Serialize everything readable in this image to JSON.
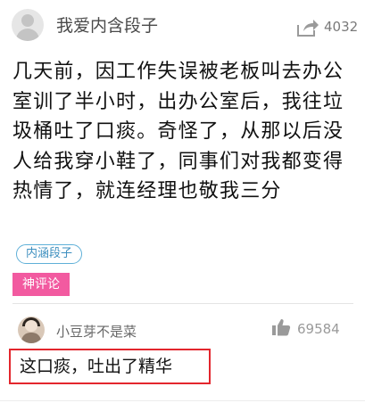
{
  "post": {
    "author": "我爱内含段子",
    "share_count": "4032",
    "content": "几天前，因工作失误被老板叫去办公室训了半小时，出办公室后，我往垃圾桶吐了口痰。奇怪了，从那以后没人给我穿小鞋了，同事们对我都变得热情了，就连经理也敬我三分",
    "tag": "内涵段子"
  },
  "god_comment": {
    "label": "神评论",
    "author": "小豆芽不是菜",
    "like_count": "69584",
    "text": "这口痰，吐出了精华"
  },
  "colors": {
    "tag_border": "#5fb0d8",
    "god_badge": "#f25aa0",
    "highlight_box": "#e3262d"
  },
  "icons": [
    "avatar-placeholder",
    "share-icon",
    "thumb-up-icon"
  ]
}
